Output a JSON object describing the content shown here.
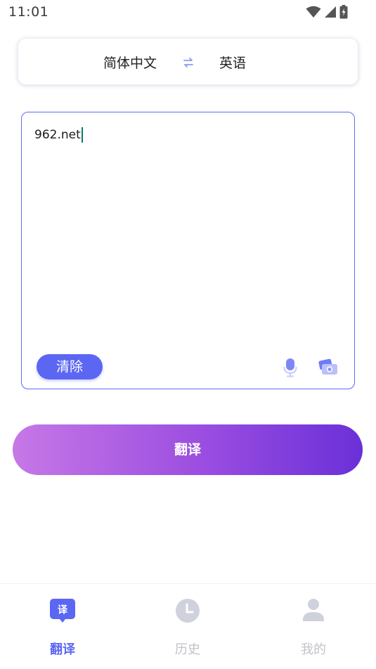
{
  "status_bar": {
    "time": "11:01",
    "icons": [
      "wifi-icon",
      "cell-signal-icon",
      "battery-charging-icon"
    ]
  },
  "language_bar": {
    "source": "简体中文",
    "target": "英语",
    "swap_icon": "swap-arrows-icon"
  },
  "input": {
    "value": "962.net",
    "clear_label": "清除",
    "mic_icon": "microphone-icon",
    "camera_icon": "camera-icon"
  },
  "translate_button": {
    "label": "翻译"
  },
  "bottom_nav": {
    "items": [
      {
        "label": "翻译",
        "icon": "translate-bubble-icon",
        "active": true
      },
      {
        "label": "历史",
        "icon": "clock-icon",
        "active": false
      },
      {
        "label": "我的",
        "icon": "person-icon",
        "active": false
      }
    ]
  },
  "colors": {
    "accent": "#5b67f3",
    "gradient_start": "#c678e6",
    "gradient_end": "#6a30d8",
    "inactive": "#c2c2c8"
  }
}
